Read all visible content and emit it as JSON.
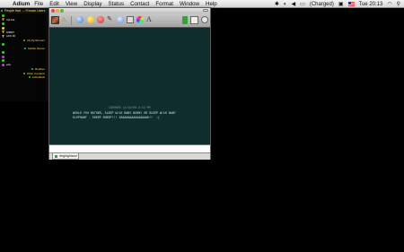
{
  "menubar": {
    "apple": "",
    "app": "Adium",
    "menus": [
      "File",
      "Edit",
      "View",
      "Display",
      "Status",
      "Contact",
      "Format",
      "Window",
      "Help"
    ],
    "battery": "(Charged)",
    "clock": "Tue 20:13"
  },
  "contact_list": {
    "title": "People that ... / Known Users",
    "rows": [
      {
        "label": "",
        "style": "left"
      },
      {
        "label": "trpt bot",
        "style": "left"
      },
      {
        "label": "",
        "style": "left"
      },
      {
        "label": "",
        "style": "left"
      },
      {
        "label": "AIRDT",
        "style": "left"
      },
      {
        "label": "ACK RI",
        "style": "left"
      },
      {
        "label": "My Performers",
        "style": "right"
      },
      {
        "label": "",
        "style": "left"
      },
      {
        "label": "Mobile Device",
        "style": "right"
      },
      {
        "label": "",
        "style": "left"
      },
      {
        "label": "",
        "style": "left"
      },
      {
        "label": "",
        "style": "left"
      },
      {
        "label": "erik",
        "style": "left"
      },
      {
        "label": "Buddies",
        "style": "right"
      },
      {
        "label": "Other Contacts",
        "style": "right"
      },
      {
        "label": "Individuals",
        "style": "right"
      }
    ]
  },
  "chat": {
    "header": "DIEHGHI 11/10/09 8:13 PM",
    "message": "WOULD YOU RATHER, SLEEP W/10 BABY BUNNY OR SLEEP W/10 BABY\nELEPHANT - SHEEP SHEEP!!! ZAAAAAAAAAAAAAAAH!!  :(",
    "input_value": "",
    "tab_label": "dirghighland"
  },
  "icons": {
    "warning": "⚠",
    "link": "✎",
    "font": "A"
  }
}
